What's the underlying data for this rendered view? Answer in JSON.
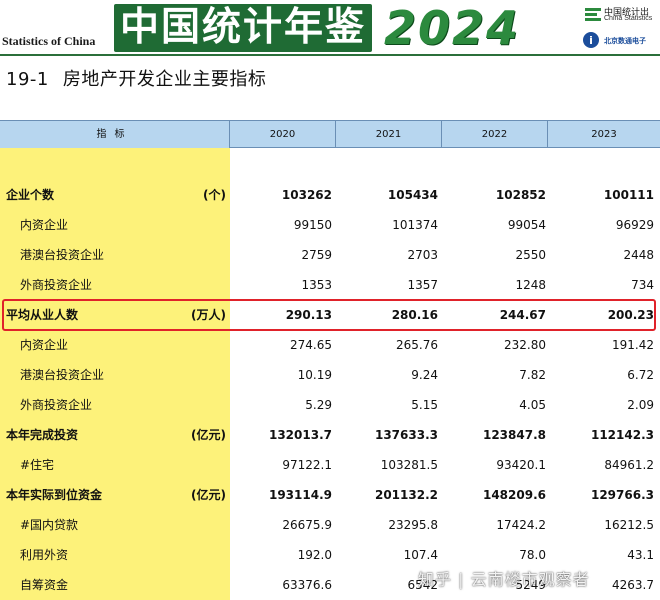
{
  "banner": {
    "subtitle_en": "Statistics of China",
    "title_cn": "中国统计年鉴",
    "year": "2024",
    "nbs_cn": "中国统计出",
    "nbs_en": "China Statistics",
    "bj_cn": "北京数通电子"
  },
  "table_title": {
    "number": "19-1",
    "text": "房地产开发企业主要指标"
  },
  "header": {
    "indicator": "指标",
    "years": [
      "2020",
      "2021",
      "2022",
      "2023"
    ]
  },
  "rows": [
    {
      "label": "企业个数",
      "unit": "(个)",
      "bold": true,
      "values": [
        "103262",
        "105434",
        "102852",
        "100111"
      ]
    },
    {
      "label": "内资企业",
      "unit": "",
      "bold": false,
      "values": [
        "99150",
        "101374",
        "99054",
        "96929"
      ]
    },
    {
      "label": "港澳台投资企业",
      "unit": "",
      "bold": false,
      "values": [
        "2759",
        "2703",
        "2550",
        "2448"
      ]
    },
    {
      "label": "外商投资企业",
      "unit": "",
      "bold": false,
      "values": [
        "1353",
        "1357",
        "1248",
        "734"
      ]
    },
    {
      "label": "平均从业人数",
      "unit": "(万人)",
      "bold": true,
      "values": [
        "290.13",
        "280.16",
        "244.67",
        "200.23"
      ]
    },
    {
      "label": "内资企业",
      "unit": "",
      "bold": false,
      "values": [
        "274.65",
        "265.76",
        "232.80",
        "191.42"
      ]
    },
    {
      "label": "港澳台投资企业",
      "unit": "",
      "bold": false,
      "values": [
        "10.19",
        "9.24",
        "7.82",
        "6.72"
      ]
    },
    {
      "label": "外商投资企业",
      "unit": "",
      "bold": false,
      "values": [
        "5.29",
        "5.15",
        "4.05",
        "2.09"
      ]
    },
    {
      "label": "本年完成投资",
      "unit": "(亿元)",
      "bold": true,
      "values": [
        "132013.7",
        "137633.3",
        "123847.8",
        "112142.3"
      ]
    },
    {
      "label": "#住宅",
      "unit": "",
      "bold": false,
      "values": [
        "97122.1",
        "103281.5",
        "93420.1",
        "84961.2"
      ]
    },
    {
      "label": "本年实际到位资金",
      "unit": "(亿元)",
      "bold": true,
      "values": [
        "193114.9",
        "201132.2",
        "148209.6",
        "129766.3"
      ]
    },
    {
      "label": "#国内贷款",
      "unit": "",
      "bold": false,
      "values": [
        "26675.9",
        "23295.8",
        "17424.2",
        "16212.5"
      ]
    },
    {
      "label": "利用外资",
      "unit": "",
      "bold": false,
      "values": [
        "192.0",
        "107.4",
        "78.0",
        "43.1"
      ]
    },
    {
      "label": "自筹资金",
      "unit": "",
      "bold": false,
      "values": [
        "63376.6",
        "6542",
        "5249",
        "4263.7"
      ]
    }
  ],
  "watermark": "知乎 | 云南楼市观察者",
  "colors": {
    "banner_green": "#1f6b34",
    "header_blue": "#b7d6ef",
    "indicator_yellow": "#fdf27a",
    "highlight_red": "#e0222a"
  }
}
